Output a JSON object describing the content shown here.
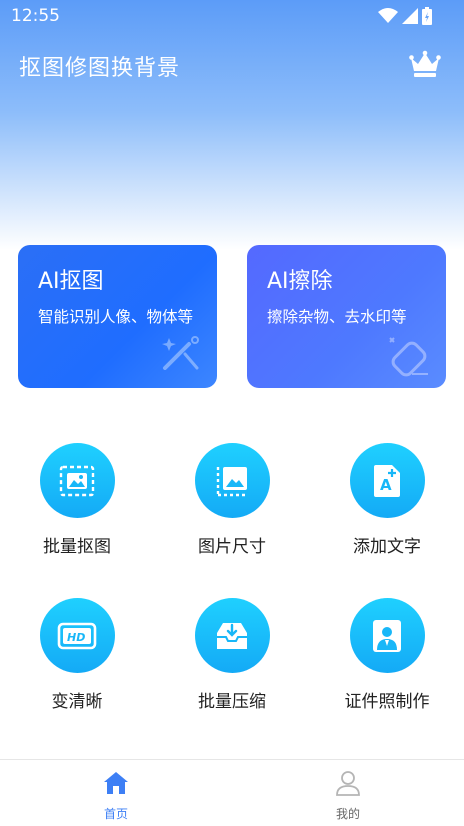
{
  "status_bar": {
    "time": "12:55"
  },
  "header": {
    "title": "抠图修图换背景",
    "vip_icon": "crown-icon"
  },
  "cards": [
    {
      "title": "AI抠图",
      "subtitle": "智能识别人像、物体等",
      "icon": "magic-wand-icon"
    },
    {
      "title": "AI擦除",
      "subtitle": "擦除杂物、去水印等",
      "icon": "eraser-icon"
    }
  ],
  "tools": [
    {
      "label": "批量抠图",
      "icon": "batch-cutout-icon"
    },
    {
      "label": "图片尺寸",
      "icon": "image-size-icon"
    },
    {
      "label": "添加文字",
      "icon": "add-text-icon"
    },
    {
      "label": "变清晰",
      "icon": "hd-icon"
    },
    {
      "label": "批量压缩",
      "icon": "compress-icon"
    },
    {
      "label": "证件照制作",
      "icon": "id-photo-icon"
    }
  ],
  "bottom_nav": [
    {
      "label": "首页",
      "icon": "home-icon",
      "active": true
    },
    {
      "label": "我的",
      "icon": "user-icon",
      "active": false
    }
  ],
  "colors": {
    "accent": "#3d7ff5",
    "tool_circle": "#18bdfb",
    "nav_inactive": "#666666"
  }
}
